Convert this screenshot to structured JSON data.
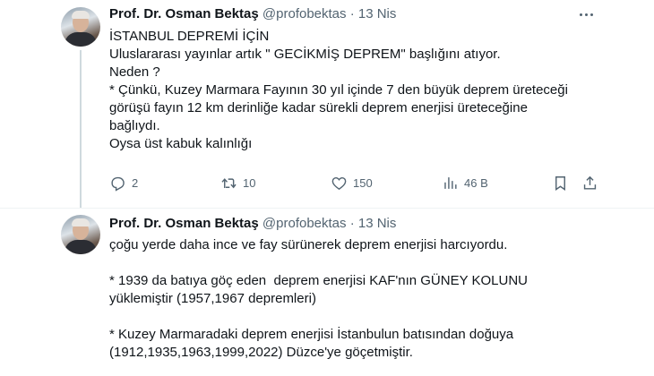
{
  "tweets": [
    {
      "author_name": "Prof. Dr. Osman Bektaş",
      "handle": "@profobektas",
      "separator": "·",
      "time": "13 Nis",
      "lines": [
        "İSTANBUL DEPREMİ İÇİN",
        "Uluslararası yayınlar artık \" GECİKMİŞ DEPREM\" başlığını atıyor.",
        "Neden ?",
        "* Çünkü, Kuzey Marmara Fayının 30 yıl içinde 7 den büyük deprem üreteceği",
        "görüşü fayın 12 km derinliğe kadar sürekli deprem enerjisi üreteceğine",
        "bağlıydı.",
        "Oysa üst kabuk kalınlığı"
      ],
      "actions": {
        "reply_icon": "reply-icon",
        "reply_count": "2",
        "retweet_icon": "retweet-icon",
        "retweet_count": "10",
        "like_icon": "heart-icon",
        "like_count": "150",
        "views_icon": "views-icon",
        "views_count": "46 B",
        "bookmark_icon": "bookmark-icon",
        "share_icon": "share-icon"
      }
    },
    {
      "author_name": "Prof. Dr. Osman Bektaş",
      "handle": "@profobektas",
      "separator": "·",
      "time": "13 Nis",
      "lines": [
        "çoğu yerde daha ince ve fay sürünerek deprem enerjisi harcıyordu.",
        "",
        "* 1939 da batıya göç eden  deprem enerjisi KAF'nın GÜNEY KOLUNU",
        "yüklemiştir (1957,1967 depremleri)",
        "",
        "* Kuzey Marmaradaki deprem enerjisi İstanbulun batısından doğuya",
        "(1912,1935,1963,1999,2022) Düzce'ye göçetmiştir."
      ]
    }
  ],
  "colors": {
    "text": "#0f1419",
    "secondary": "#536471",
    "divider": "#eff3f4",
    "thread": "#cfd9de"
  }
}
